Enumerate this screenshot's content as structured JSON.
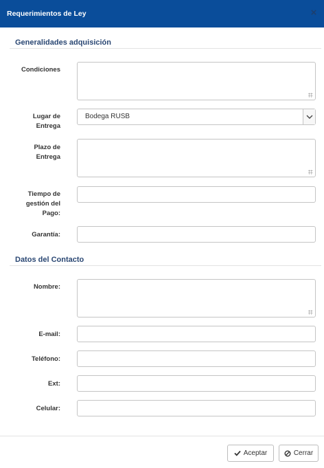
{
  "dialog": {
    "title": "Requerimientos de Ley",
    "close_glyph": "×"
  },
  "sections": {
    "acquisition": {
      "title": "Generalidades adquisición",
      "condiciones": {
        "label": "Condiciones",
        "value": ""
      },
      "lugar_entrega": {
        "label_line1": "Lugar de",
        "label_line2": "Entrega",
        "selected": "Bodega RUSB"
      },
      "plazo_entrega": {
        "label_line1": "Plazo de",
        "label_line2": "Entrega",
        "value": ""
      },
      "tiempo_pago": {
        "label_line1": "Tiempo de",
        "label_line2": "gestión del",
        "label_line3": "Pago:",
        "value": ""
      },
      "garantia": {
        "label": "Garantía:",
        "value": ""
      }
    },
    "contact": {
      "title": "Datos del Contacto",
      "nombre": {
        "label": "Nombre:",
        "value": ""
      },
      "email": {
        "label": "E-mail:",
        "value": ""
      },
      "telefono": {
        "label": "Teléfono:",
        "value": ""
      },
      "ext": {
        "label": "Ext:",
        "value": ""
      },
      "celular": {
        "label": "Celular:",
        "value": ""
      }
    }
  },
  "footer": {
    "accept_label": "Aceptar",
    "close_label": "Cerrar"
  },
  "icons": {
    "close": "close-icon",
    "dropdown": "chevron-down-icon",
    "accept": "check-icon",
    "cancel": "ban-icon"
  },
  "colors": {
    "header_bg": "#0a4d9a",
    "section_title": "#2a4773"
  }
}
